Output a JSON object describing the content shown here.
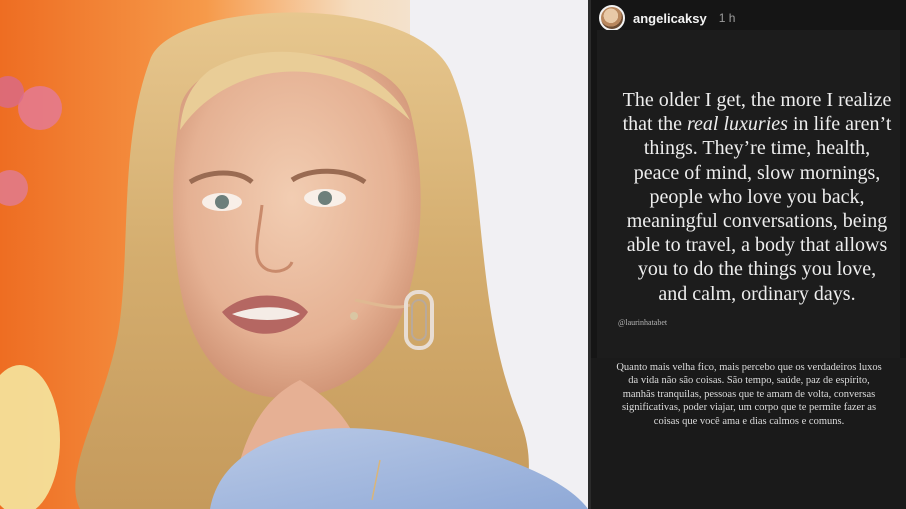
{
  "story": {
    "username": "angelicaksy",
    "timestamp": "1 h",
    "quote_part1": "The older I get, the more I realize that the ",
    "quote_emphasis": "real luxuries",
    "quote_part2": " in life aren’t things. They’re time, health, peace of mind, slow mornings, people who love you back, meaningful conversations, being able to travel, a body that allows you to do the things you love, and calm, ordinary days.",
    "credit": "@laurinhatabet",
    "translation": "Quanto mais velha fico, mais percebo que os verdadeiros luxos da vida não são coisas. São tempo, saúde, paz de espírito, manhãs tranquilas, pessoas que te amam de volta, conversas significativas, poder viajar, um corpo que te permite fazer as coisas que você ama e dias calmos e comuns."
  },
  "colors": {
    "background": "#151515",
    "text": "#ededed",
    "photo_bg": "#f07a2a"
  },
  "photo": {
    "subject": "woman-with-blonde-hair-and-earrings"
  }
}
